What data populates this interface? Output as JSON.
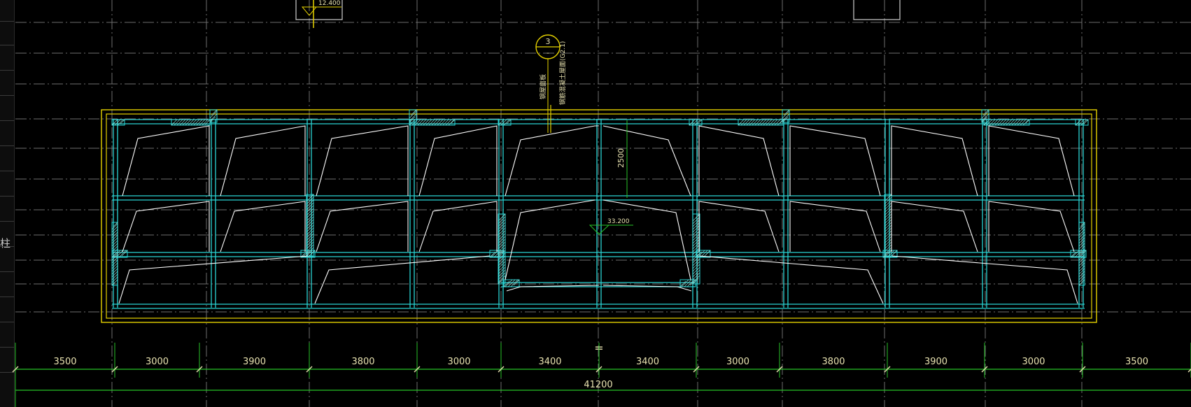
{
  "colors": {
    "background": "#000000",
    "grid": "#6e6e6e",
    "axis": "#9a9a9a",
    "wall_outline": "#e6d200",
    "beam": "#2ad4d4",
    "slope_line": "#ffffff",
    "dimension": "#27c227",
    "dimension_text": "#e8e2b0",
    "hatch": "#2ad4d4"
  },
  "left_panel": {
    "char": "柱"
  },
  "annotations": {
    "elevation_top": "12.400",
    "elevation_center": "33.200",
    "section_number": "3",
    "section_sub": "-",
    "callout_text_1": "钢屋面板",
    "callout_text_2": "钢筋混凝土屋面(G2.1)",
    "vertical_dim": "2500",
    "equal_mark": "="
  },
  "dimensions": {
    "segments": [
      "3500",
      "3000",
      "3900",
      "3800",
      "3000",
      "3400",
      "3400",
      "3000",
      "3800",
      "3900",
      "3000",
      "3500"
    ],
    "total": "41200"
  }
}
